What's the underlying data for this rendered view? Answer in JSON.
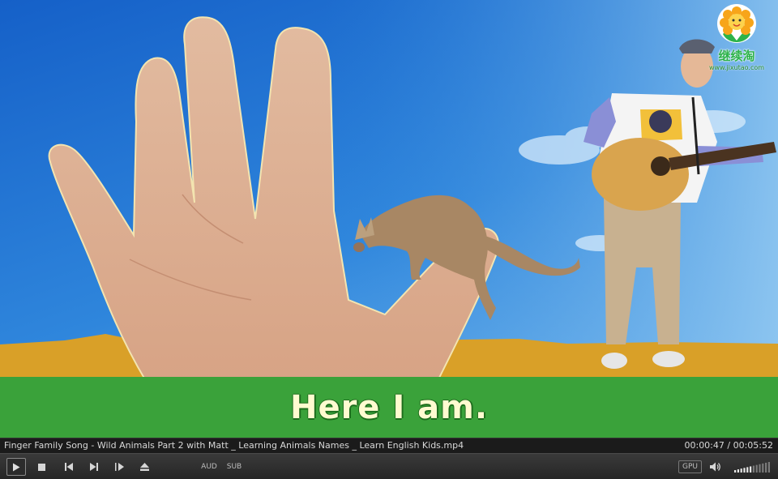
{
  "video": {
    "caption": "Here I am.",
    "watermark_brand": "继续淘",
    "watermark_url": "www.jixutao.com"
  },
  "status": {
    "filename": "Finger Family Song - Wild Animals Part 2 with Matt _ Learning Animals Names _ Learn English Kids.mp4",
    "current_time": "00:00:47",
    "total_time": "00:05:52",
    "separator": " / ",
    "progress_fraction": 0.1335
  },
  "controls": {
    "play_icon": "play-icon",
    "stop_icon": "stop-icon",
    "prev_icon": "previous-icon",
    "next_icon": "next-icon",
    "frame_step_icon": "frame-step-icon",
    "eject_icon": "eject-icon",
    "aud_label": "AUD",
    "sub_label": "SUB",
    "gpu_label": "GPU",
    "volume_icon": "speaker-icon",
    "volume_level": 0.55
  },
  "colors": {
    "sky": "#2a7fd8",
    "ground": "#d9a028",
    "caption_band": "#3aa23a",
    "caption_text": "#fffbd0"
  }
}
